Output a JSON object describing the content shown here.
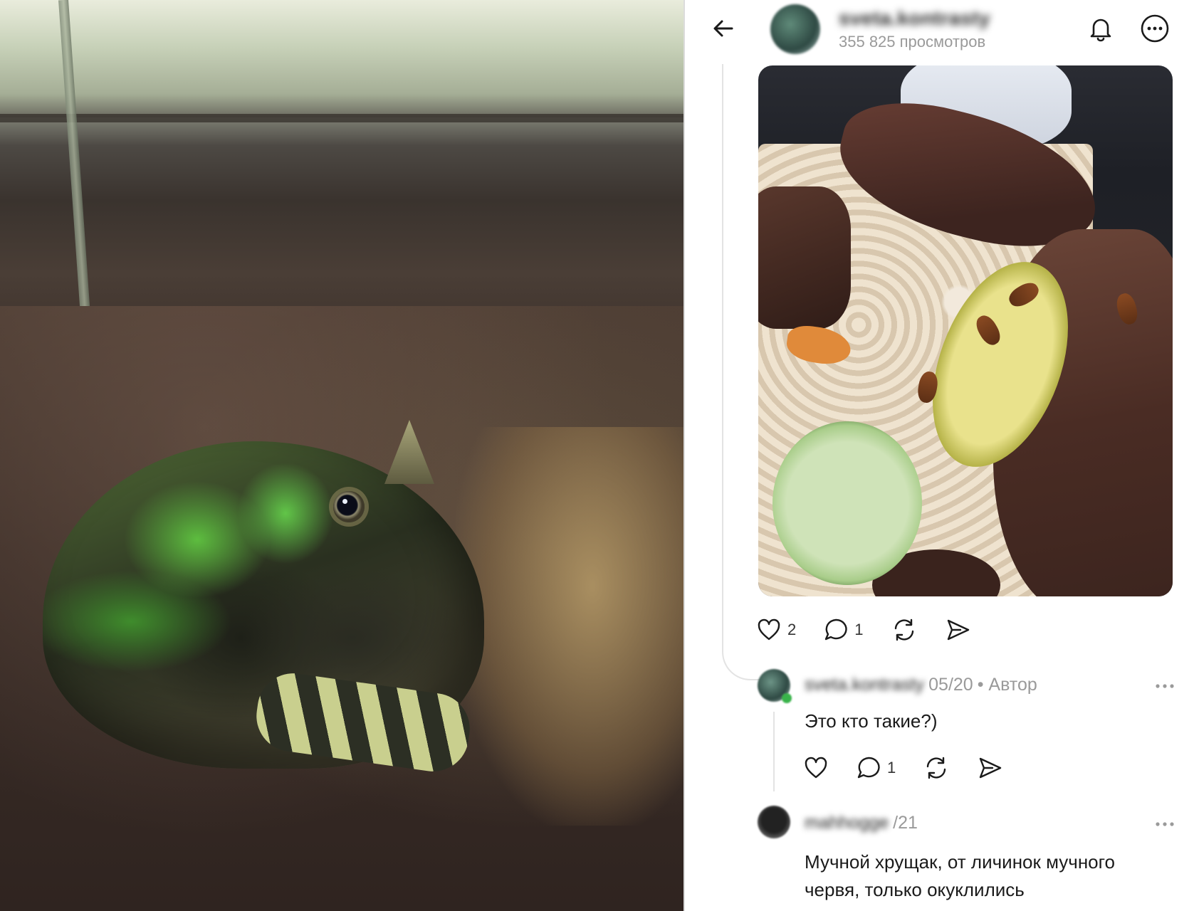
{
  "header": {
    "username": "sveta.kontrasty",
    "views": "355 825 просмотров"
  },
  "post": {
    "likes": "2",
    "comments": "1"
  },
  "comments": [
    {
      "username": "sveta.kontrasty",
      "date": "05/20",
      "author_badge": "• Автор",
      "text": "Это кто такие?)",
      "likes": "",
      "replies": "1"
    },
    {
      "username": "mahhogge",
      "date": "/21",
      "text": "Мучной хрущак, от личинок мучного червя, только окуклились"
    }
  ],
  "icons": {
    "back": "arrow-left-icon",
    "notifications": "bell-icon",
    "more": "ellipsis-circle-icon",
    "like": "heart-icon",
    "comment": "speech-bubble-icon",
    "repost": "repost-arrows-icon",
    "share": "paper-plane-icon"
  },
  "colors": {
    "background": "#ffffff",
    "text": "#1a1a1a",
    "muted": "#9a9a9a",
    "online_badge": "#39b34a"
  }
}
